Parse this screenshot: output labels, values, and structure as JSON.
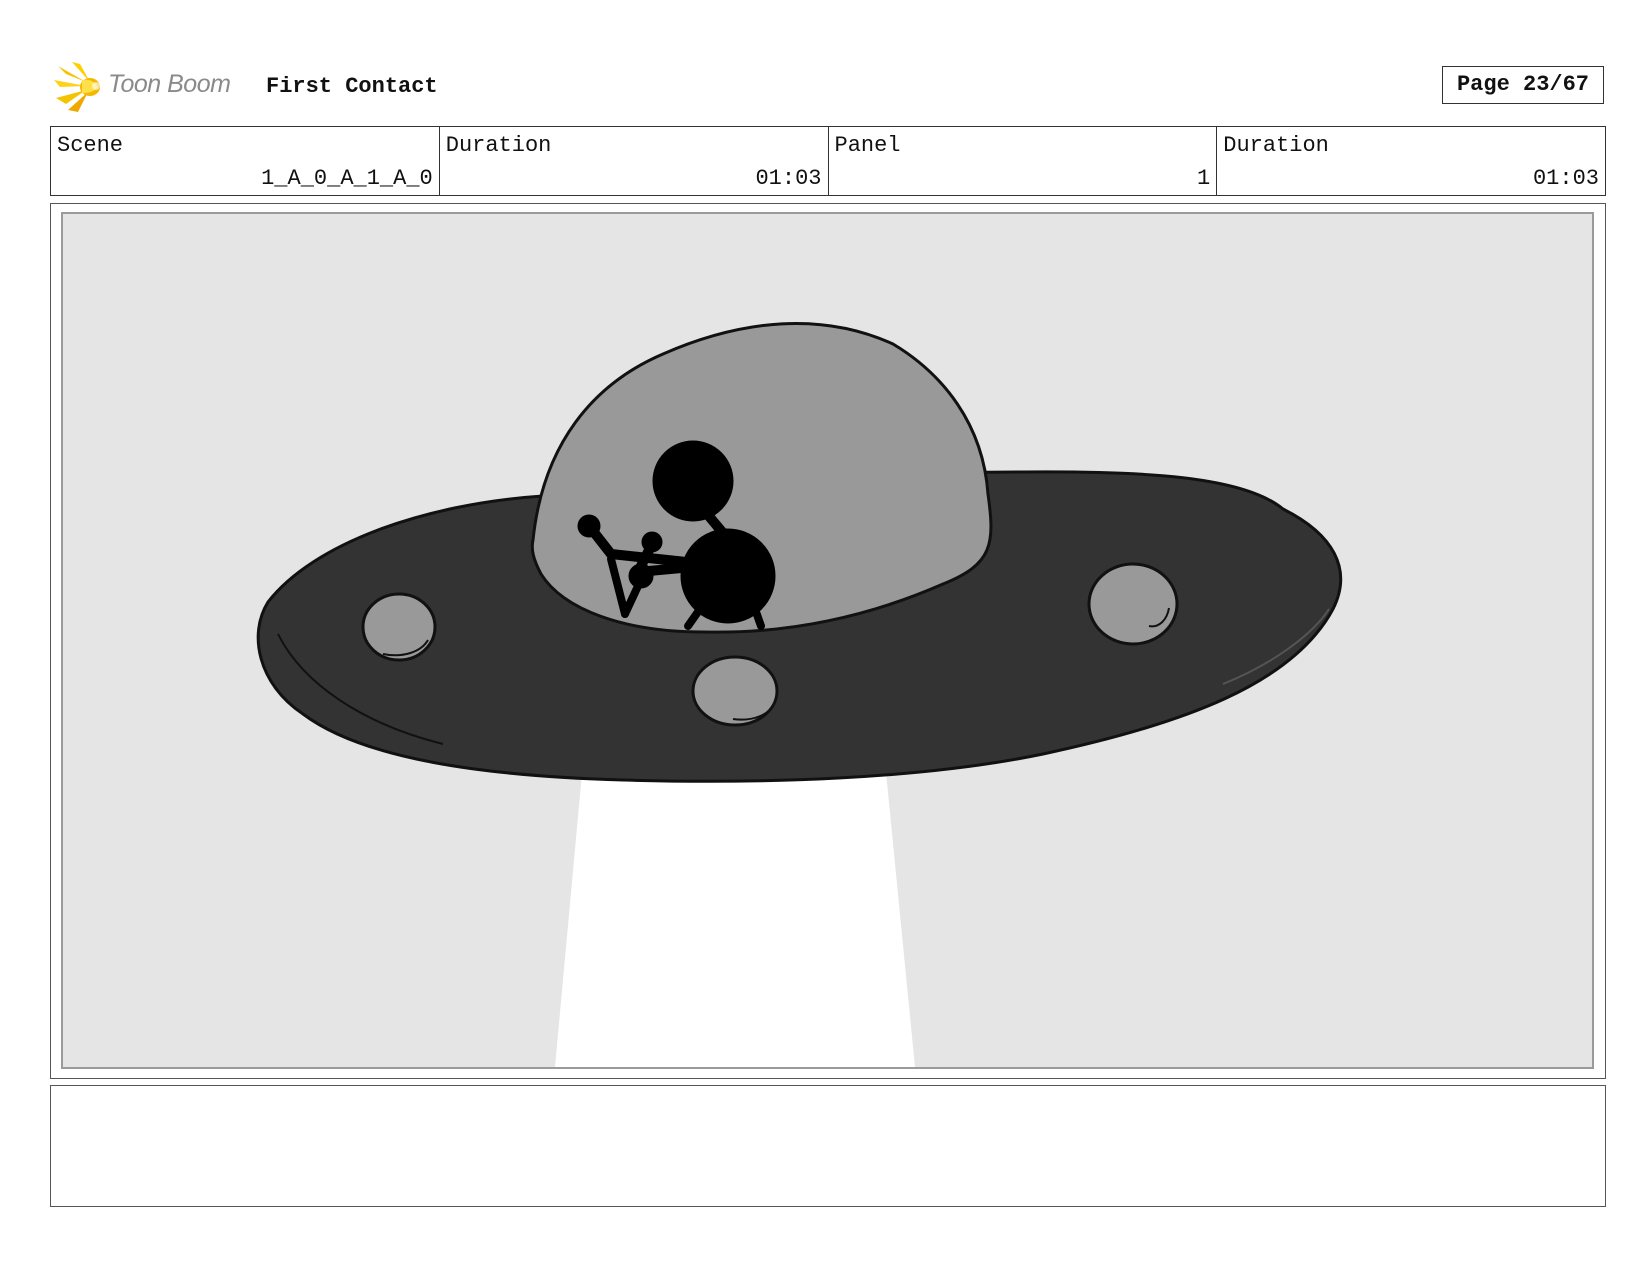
{
  "header": {
    "logo_text": "Toon Boom",
    "project_title": "First Contact",
    "page_label": "Page 23/67"
  },
  "info": [
    {
      "label": "Scene",
      "value": "1_A_0_A_1_A_0"
    },
    {
      "label": "Duration",
      "value": "01:03"
    },
    {
      "label": "Panel",
      "value": "1"
    },
    {
      "label": "Duration",
      "value": "01:03"
    }
  ],
  "panel": {
    "background_color": "#e5e5e5",
    "saucer_color": "#333333",
    "dome_color": "#999999",
    "beam_color": "#ffffff",
    "alien_color": "#000000"
  },
  "notes": {
    "text": ""
  }
}
